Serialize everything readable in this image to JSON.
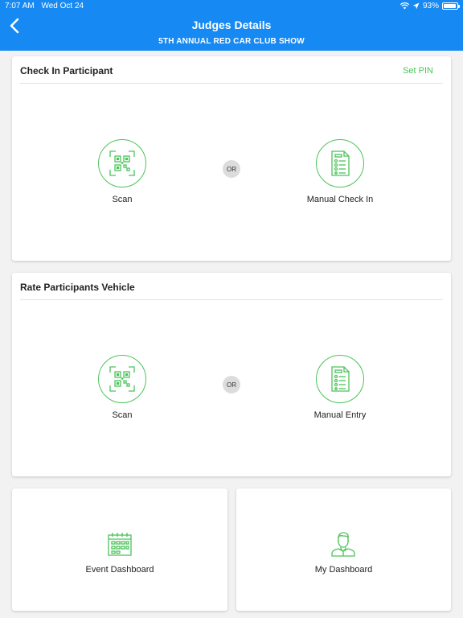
{
  "status_bar": {
    "time": "7:07 AM",
    "date": "Wed Oct 24",
    "battery": "93%",
    "battery_level": 0.93
  },
  "header": {
    "title": "Judges Details",
    "subtitle": "5TH ANNUAL RED CAR CLUB SHOW"
  },
  "check_in": {
    "title": "Check In Participant",
    "set_pin_label": "Set PIN",
    "scan_label": "Scan",
    "or_label": "OR",
    "manual_label": "Manual Check In"
  },
  "rate": {
    "title": "Rate Participants Vehicle",
    "scan_label": "Scan",
    "or_label": "OR",
    "manual_label": "Manual Entry"
  },
  "dashboards": {
    "event_label": "Event Dashboard",
    "my_label": "My Dashboard"
  },
  "colors": {
    "header_blue": "#1789f2",
    "accent_green": "#4cc35a"
  }
}
